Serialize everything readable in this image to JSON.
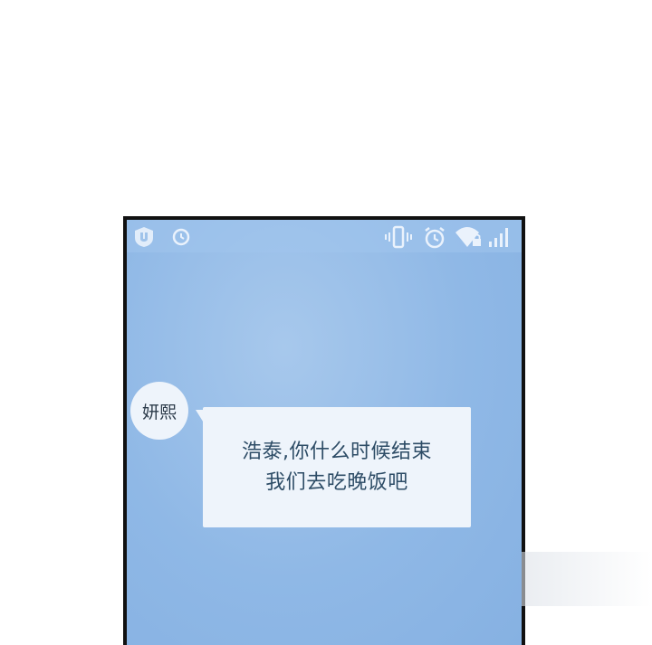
{
  "status_bar": {
    "left_icons": [
      "app-shield-icon",
      "alarm-clock-icon"
    ],
    "right_icons": [
      "vibrate-icon",
      "alarm-clock-icon",
      "wifi-icon",
      "signal-bars-icon"
    ]
  },
  "chat": {
    "sender_name": "妍熙",
    "message_line_1": "浩泰,你什么时候结束",
    "message_line_2": "我们去吃晚饭吧"
  },
  "colors": {
    "screen_background": "#8fb8e6",
    "bubble_background": "#eef4fb",
    "message_text": "#2d4c66",
    "frame_border": "#111111"
  }
}
